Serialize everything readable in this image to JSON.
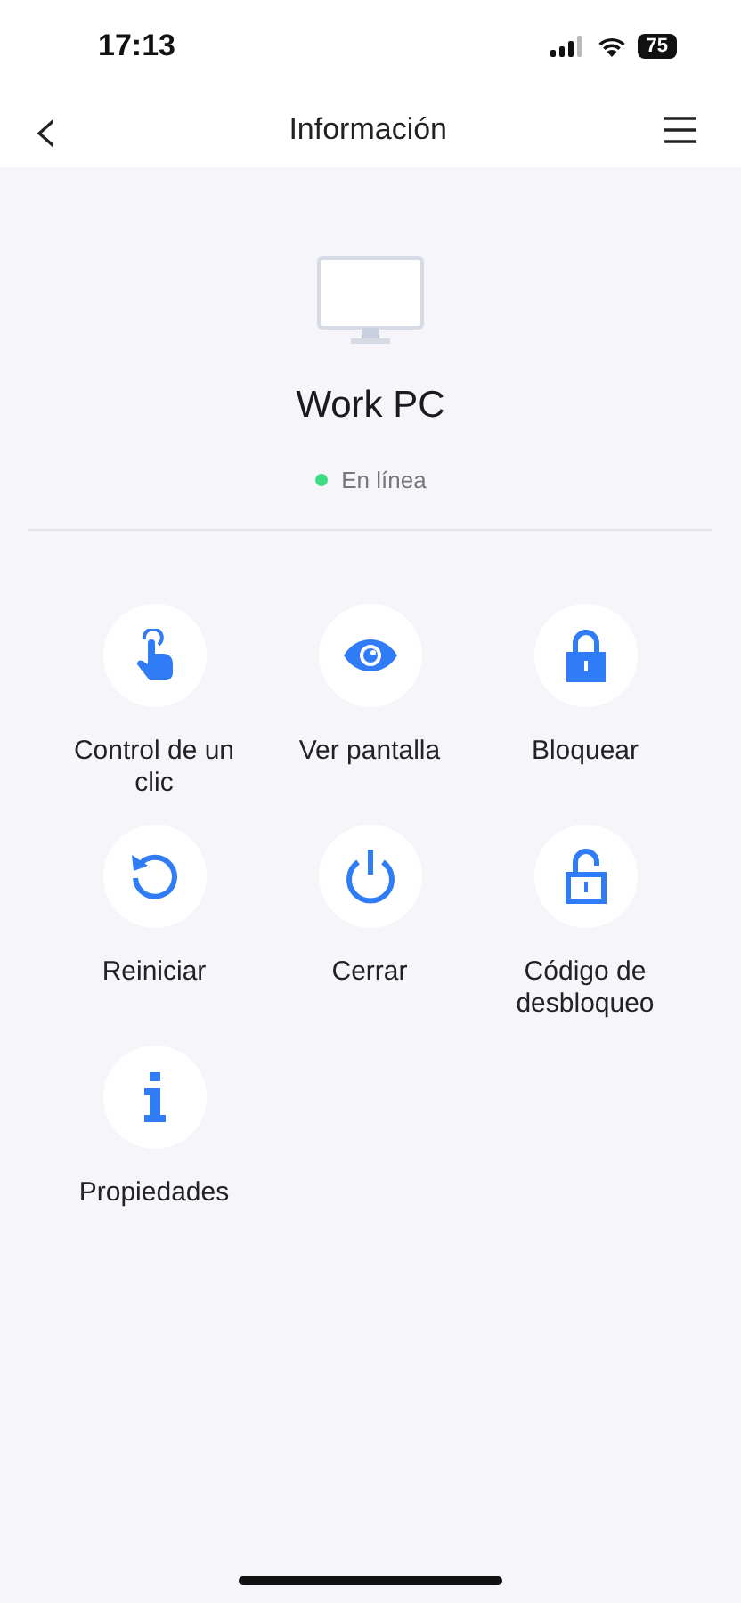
{
  "status_bar": {
    "time": "17:13",
    "battery": "75"
  },
  "nav": {
    "back": "‹",
    "title": "Información"
  },
  "device": {
    "name": "Work PC",
    "status": {
      "label": "En línea",
      "color": "#3ddc84"
    }
  },
  "actions": [
    {
      "kind": "touch",
      "label": "Control de un clic"
    },
    {
      "kind": "eye",
      "label": "Ver pantalla"
    },
    {
      "kind": "lock",
      "label": "Bloquear"
    },
    {
      "kind": "restart",
      "label": "Reiniciar"
    },
    {
      "kind": "power",
      "label": "Cerrar"
    },
    {
      "kind": "unlock",
      "label": "Código de desbloqueo"
    },
    {
      "kind": "info",
      "label": "Propiedades"
    }
  ]
}
